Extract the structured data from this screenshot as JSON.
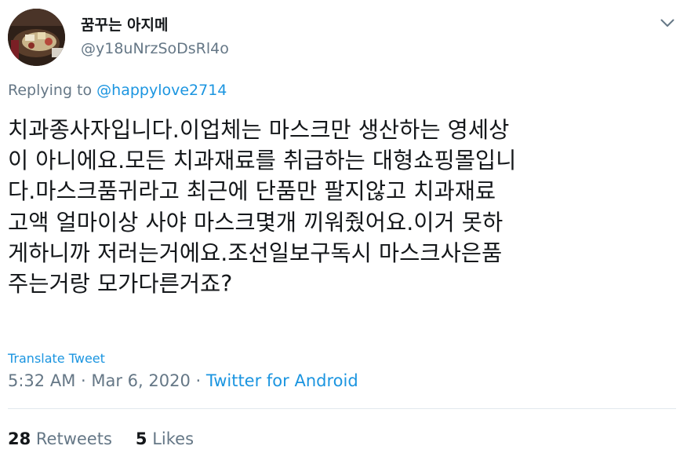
{
  "author": {
    "display_name": "꿈꾸는 아지메",
    "handle": "@y18uNrzSoDsRl4o",
    "avatar": "food-platter-photo"
  },
  "menu_icon": "chevron-down-icon",
  "reply": {
    "prefix": "Replying to ",
    "mention": "@happylove2714"
  },
  "tweet": {
    "lines": [
      "치과종사자입니다.이업체는 마스크만 생산하는 영세상",
      "이 아니에요.모든 치과재료를 취급하는 대형쇼핑몰입니",
      "다.마스크품귀라고 최근에 단품만 팔지않고 치과재료",
      "고액 얼마이상 사야 마스크몇개 끼워줬어요.이거 못하",
      "게하니까 저러는거에요.조선일보구독시 마스크사은품",
      "주는거랑 모가다른거죠?"
    ]
  },
  "translate_label": "Translate Tweet",
  "meta": {
    "time": "5:32 AM",
    "separator1": " · ",
    "date": "Mar 6, 2020",
    "separator2": " · ",
    "source": "Twitter for Android"
  },
  "stats": {
    "retweets_count": "28",
    "retweets_label": " Retweets",
    "likes_count": "5",
    "likes_label": " Likes"
  },
  "colors": {
    "text": "#14171a",
    "secondary": "#657786",
    "link": "#1b95e0",
    "divider": "#e1e8ed"
  }
}
